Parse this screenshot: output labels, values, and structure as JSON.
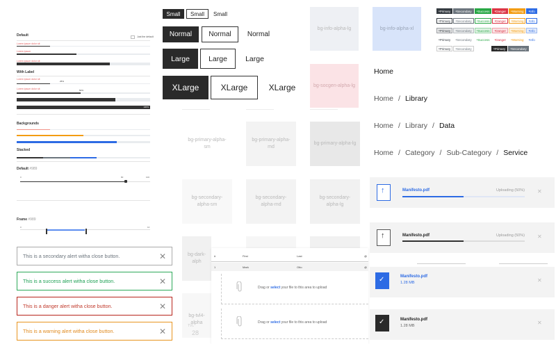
{
  "progress": {
    "default_label": "Default",
    "default_small_label": "Just the default",
    "default_sublabels": [
      "Lorem ipsum dolor sit",
      "Lorem ipsum",
      "Lorem ipsum dolor sit"
    ],
    "default_values": [
      0.25,
      0.45,
      0.7
    ],
    "with_label_title": "With Label",
    "with_label_items": [
      {
        "caption": "Lorem ipsum dolor sit",
        "pct": "25%",
        "value": 0.25
      },
      {
        "caption": "Lorem ipsum dolor sit",
        "pct": "50%",
        "value": 0.48
      },
      {
        "caption": "",
        "pct": "75%",
        "value": 0.74
      },
      {
        "caption": "",
        "pct": "100%",
        "value": 1.0
      }
    ],
    "backgrounds_title": "Backgrounds",
    "background_values": [
      0.25,
      0.5,
      0.75
    ],
    "background_colors": [
      "#f1948a",
      "#f39c12",
      "#2d6be4"
    ],
    "stacked_title": "Stacked",
    "default_slider_title": "Default",
    "default_slider_accent": "#989",
    "default_slider_value": 0.8,
    "default_slider_min": "0",
    "default_slider_max": "100",
    "default_slider_thumb": "80",
    "frame_title": "Frame",
    "frame_accent": "#989",
    "frame_min": "0",
    "frame_max": "10",
    "frame_range": [
      0.2,
      0.5
    ]
  },
  "alerts": [
    {
      "text": "This is a secondary alert witha close button.",
      "color": "#6c757d",
      "border": "#aaaaaa"
    },
    {
      "text": "This is a success alert witha close button.",
      "color": "#1fa055",
      "border": "#2ca858"
    },
    {
      "text": "This is a danger alert witha close button.",
      "color": "#c0392b",
      "border": "#b7231a"
    },
    {
      "text": "This is a warning alert witha close button.",
      "color": "#e08a1e",
      "border": "#e8941e"
    }
  ],
  "alert_close": "✕",
  "buttons": {
    "small": [
      "Small",
      "Small",
      "Small"
    ],
    "normal": [
      "Normal",
      "Normal",
      "Normal"
    ],
    "large": [
      "Large",
      "Large",
      "Large"
    ],
    "xlarge": [
      "XLarge",
      "XLarge",
      "XLarge"
    ]
  },
  "tiles": {
    "top": [
      "bg-info-alpha-lg",
      "bg-info-alpha-xl"
    ],
    "socgen": "bg-socgen-alpha-lg",
    "primary": [
      "bg-primary-alpha-sm",
      "bg-primary-alpha-md",
      "bg-primary-alpha-lg"
    ],
    "secondary": [
      "bg-secondary-alpha-sm",
      "bg-secondary-alpha-md",
      "bg-secondary-alpha-lg"
    ],
    "dark": "bg-dark-alph",
    "bottom": "bg-tvl4-alpha",
    "bottom_tvl": "TVL",
    "bottom_num": "28"
  },
  "badges": {
    "row1": [
      "Primary",
      "Secondary",
      "Success",
      "Danger",
      "Warning",
      "Info"
    ],
    "row_colors": [
      "#343a40",
      "#6c757d",
      "#28a745",
      "#dc3545",
      "#f39c12",
      "#2d6be4"
    ],
    "row_small": [
      "Primary",
      "Secondary"
    ],
    "row_small_dark": [
      "Primary",
      "Secondary"
    ]
  },
  "breadcrumbs": [
    [
      "Home"
    ],
    [
      "Home",
      "Library"
    ],
    [
      "Home",
      "Library",
      "Data"
    ],
    [
      "Home",
      "Category",
      "Sub-Category",
      "Service"
    ]
  ],
  "breadcrumb_sep": "/",
  "uploads": [
    {
      "filename": "Manifesto.pdf",
      "status": "Uploading (50%)",
      "progress": 0.5,
      "mode": "uploading"
    },
    {
      "filename": "Manifesto.pdf",
      "status": "Uploading (50%)",
      "progress": 0.5,
      "mode": "uploading-dark"
    },
    {
      "filename": "Manifesto.pdf",
      "size": "1.28 MB",
      "mode": "done"
    },
    {
      "filename": "Manifesto.pdf",
      "size": "1.28 MB",
      "mode": "done-dark"
    }
  ],
  "upload_close": "✕",
  "table": {
    "headers": [
      "#",
      "First",
      "Last",
      "@"
    ],
    "rows": [
      [
        "1",
        "Mark",
        "Otto",
        "@"
      ]
    ]
  },
  "dropzone": {
    "prefix": "Drag or",
    "link": "select",
    "suffix": "your file to this area to upload"
  }
}
